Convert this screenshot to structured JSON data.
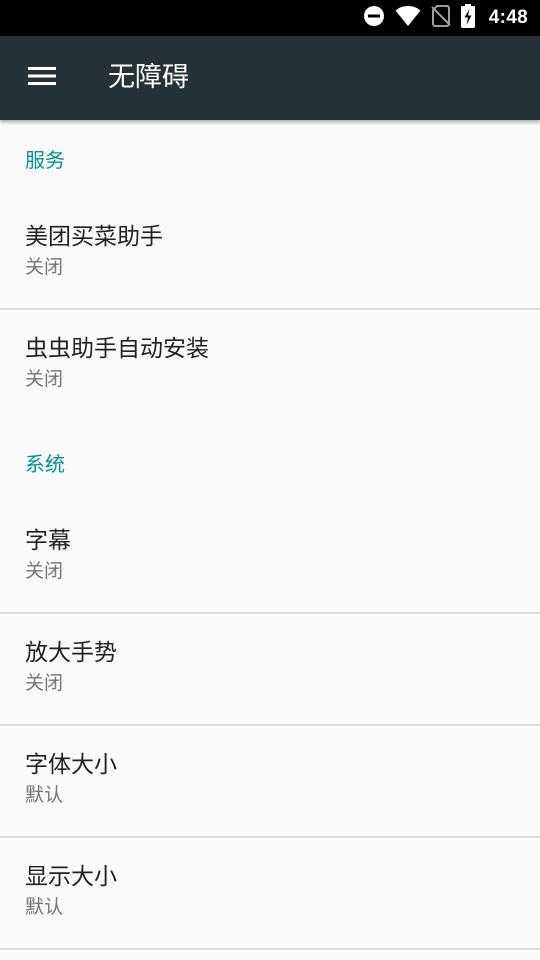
{
  "status_bar": {
    "time": "4:48",
    "icons": [
      "do-not-disturb-icon",
      "wifi-icon",
      "no-sim-icon",
      "battery-charging-icon"
    ]
  },
  "app_bar": {
    "title": "无障碍",
    "menu_icon": "menu-icon"
  },
  "categories": [
    {
      "title": "服务",
      "items": [
        {
          "title": "美团买菜助手",
          "summary": "关闭"
        },
        {
          "title": "虫虫助手自动安装",
          "summary": "关闭"
        }
      ]
    },
    {
      "title": "系统",
      "items": [
        {
          "title": "字幕",
          "summary": "关闭"
        },
        {
          "title": "放大手势",
          "summary": "关闭"
        },
        {
          "title": "字体大小",
          "summary": "默认"
        },
        {
          "title": "显示大小",
          "summary": "默认"
        }
      ]
    }
  ],
  "colors": {
    "status_bar": "#000000",
    "app_bar": "#263238",
    "accent": "#009688",
    "background": "#fafafa",
    "divider": "#dcdcdc"
  }
}
